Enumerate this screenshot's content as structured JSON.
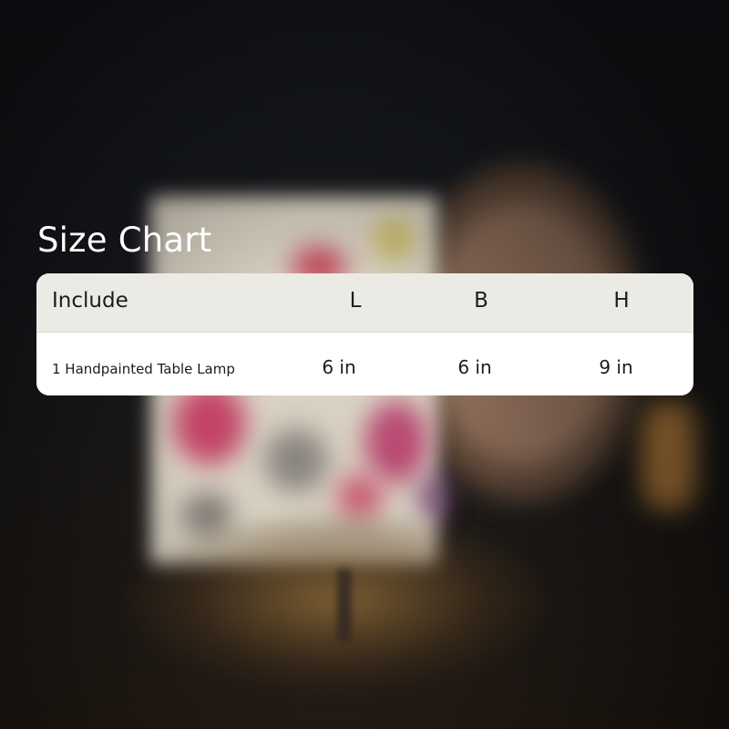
{
  "title": "Size Chart",
  "table": {
    "headers": [
      "Include",
      "L",
      "B",
      "H"
    ],
    "rows": [
      {
        "include": "1 Handpainted Table Lamp",
        "l": "6 in",
        "b": "6 in",
        "h": "9 in"
      }
    ]
  },
  "colors": {
    "title_text": "#ffffff",
    "header_row_bg": "#eceae4",
    "body_row_bg": "#ffffff",
    "table_text": "#1c1c1c"
  }
}
